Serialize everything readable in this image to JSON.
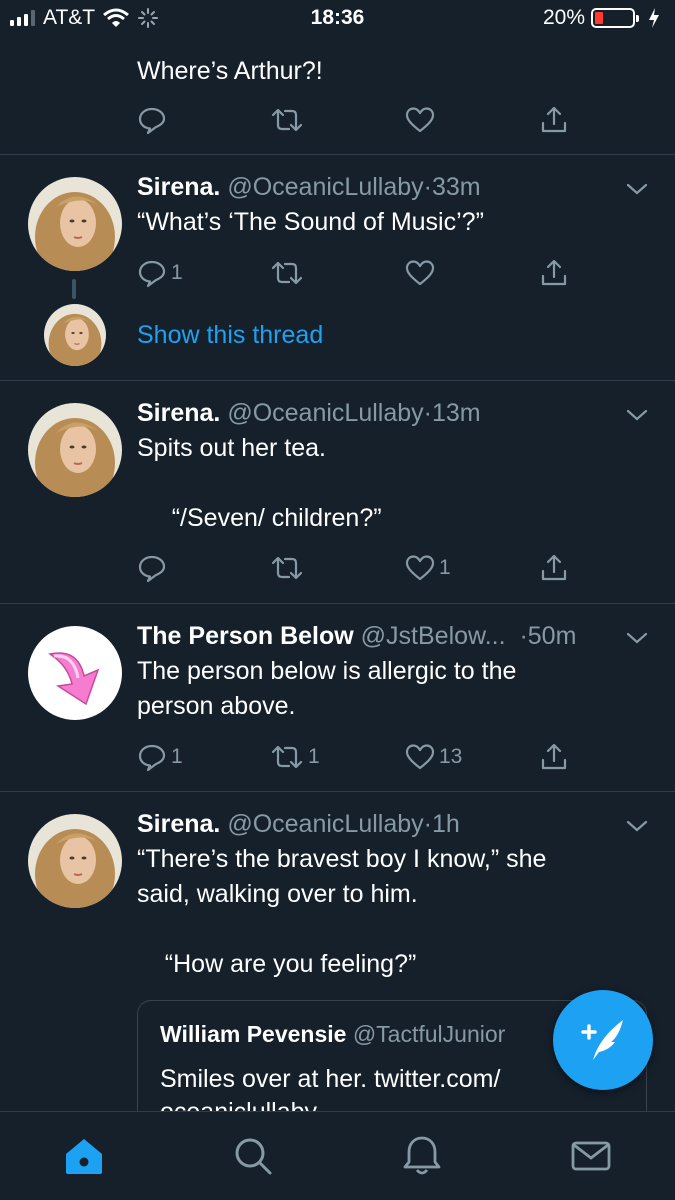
{
  "status_bar": {
    "carrier": "AT&T",
    "time": "18:36",
    "battery": "20%"
  },
  "tweets": [
    {
      "body": "Where’s Arthur?!",
      "reply_count": "",
      "retweet_count": "",
      "like_count": ""
    },
    {
      "name": "Sirena.",
      "handle": "@OceanicLullaby",
      "dot": "·",
      "time": "33m",
      "body": "“What’s ‘The Sound of Music’?”",
      "reply_count": "1",
      "retweet_count": "",
      "like_count": "",
      "show_thread": "Show this thread"
    },
    {
      "name": "Sirena.",
      "handle": "@OceanicLullaby",
      "dot": "·",
      "time": "13m",
      "body": "Spits out her tea.\n\n     “/Seven/ children?”",
      "reply_count": "",
      "retweet_count": "",
      "like_count": "1"
    },
    {
      "name": "The Person Below",
      "handle": "@JstBelow...",
      "dot": "·",
      "time": "50m",
      "body": "The person below is allergic to the\nperson above.",
      "reply_count": "1",
      "retweet_count": "1",
      "like_count": "13"
    },
    {
      "name": "Sirena.",
      "handle": "@OceanicLullaby",
      "dot": "·",
      "time": "1h",
      "body": "“There’s the bravest boy I know,” she\nsaid, walking over to him.\n\n    “How are you feeling?”",
      "quote": {
        "name": "William Pevensie",
        "handle": "@TactfulJunior",
        "text": "Smiles over at her. twitter.com/\noceaniclullaby..."
      }
    }
  ],
  "colors": {
    "background": "#15202b",
    "accent": "#1da1f2",
    "muted": "#8899a6",
    "divider": "#2f3c4a"
  },
  "icons": [
    "signal-icon",
    "wifi-icon",
    "activity-spinner-icon",
    "battery-icon",
    "charging-bolt-icon",
    "reply-icon",
    "retweet-icon",
    "like-icon",
    "share-icon",
    "chevron-down-icon",
    "compose-tweet-icon",
    "home-icon",
    "search-icon",
    "notifications-bell-icon",
    "messages-envelope-icon"
  ],
  "tabs": {
    "active": "home"
  }
}
